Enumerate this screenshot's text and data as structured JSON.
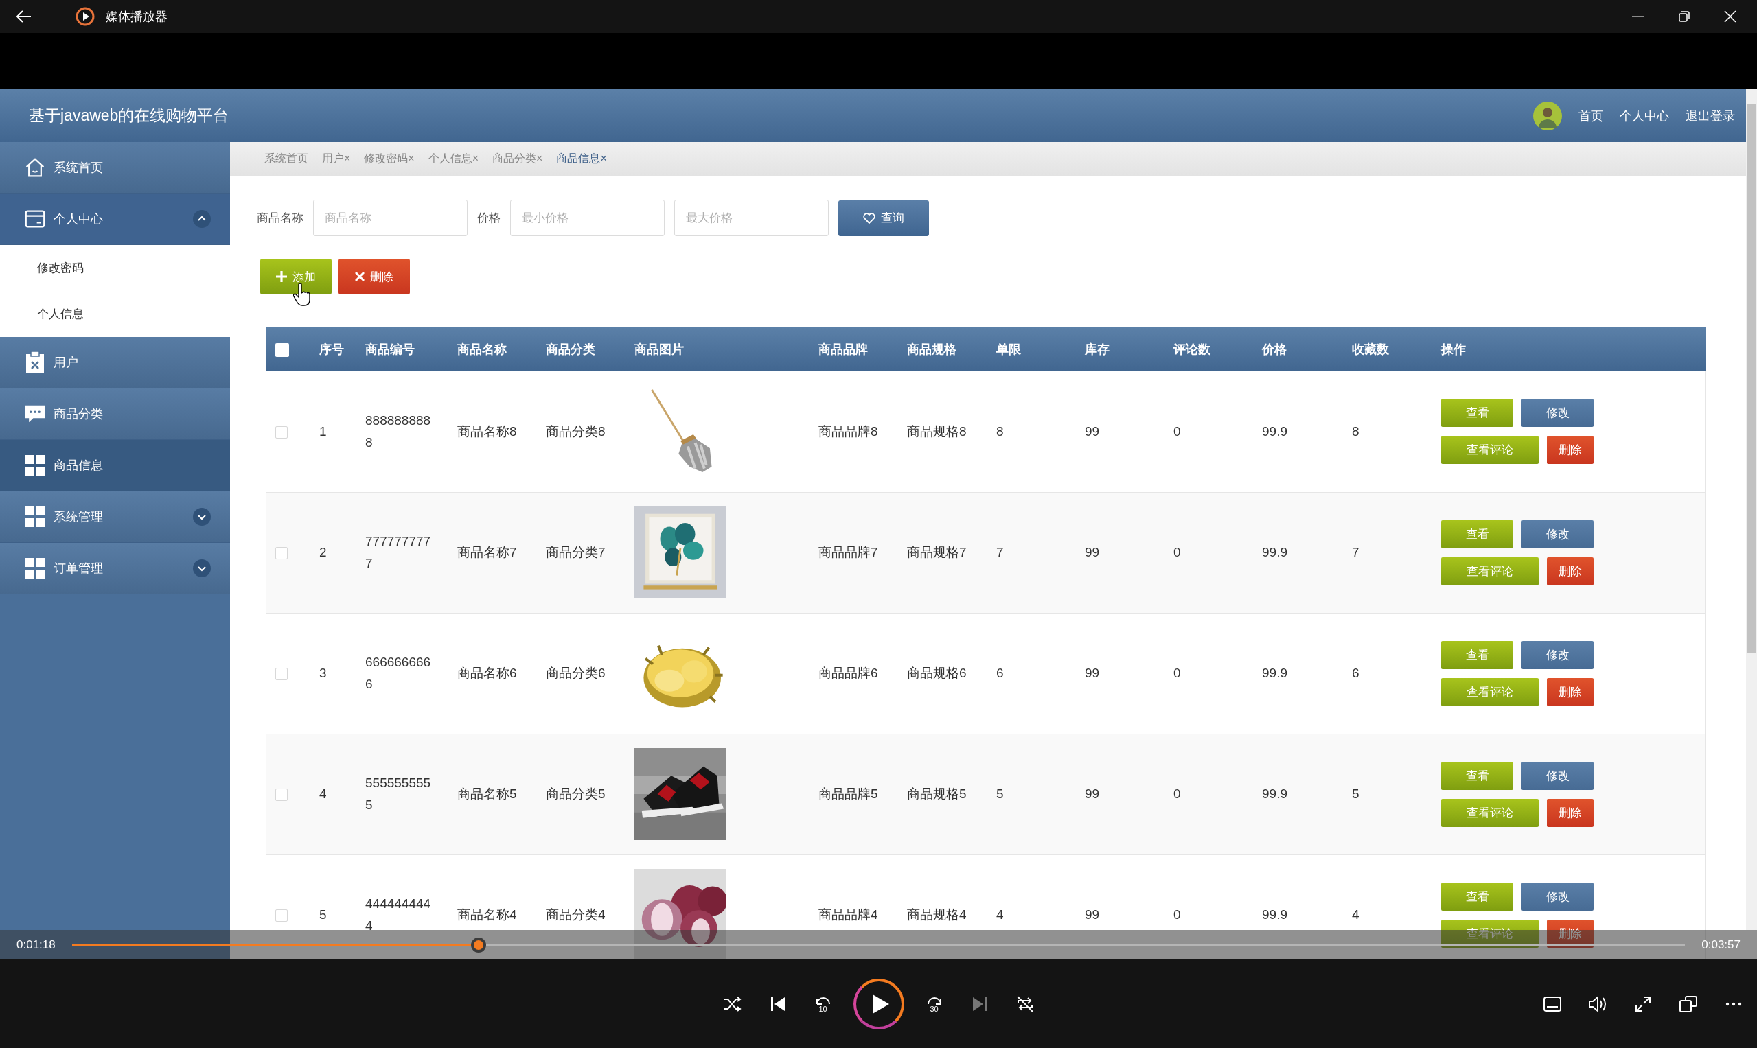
{
  "window": {
    "title": "媒体播放器"
  },
  "app": {
    "title": "基于javaweb的在线购物平台",
    "nav": [
      "首页",
      "个人中心",
      "退出登录"
    ],
    "sidebar": {
      "items": [
        {
          "label": "系统首页",
          "selected": false
        },
        {
          "label": "个人中心",
          "selected": false,
          "expanded": true,
          "children": [
            {
              "label": "修改密码"
            },
            {
              "label": "个人信息"
            }
          ]
        },
        {
          "label": "用户",
          "selected": false
        },
        {
          "label": "商品分类",
          "selected": false
        },
        {
          "label": "商品信息",
          "selected": true
        },
        {
          "label": "系统管理",
          "selected": false,
          "expanded": false
        },
        {
          "label": "订单管理",
          "selected": false,
          "expanded": false
        }
      ]
    },
    "tabs": [
      {
        "label": "系统首页",
        "selected": false
      },
      {
        "label": "用户",
        "close": "×",
        "selected": false
      },
      {
        "label": "修改密码",
        "close": "×",
        "selected": false
      },
      {
        "label": "个人信息",
        "close": "×",
        "selected": false
      },
      {
        "label": "商品分类",
        "close": "×",
        "selected": false
      },
      {
        "label": "商品信息",
        "close": "×",
        "selected": true
      }
    ],
    "search": {
      "fields": [
        {
          "label": "商品名称",
          "placeholder": "商品名称"
        },
        {
          "label": "价格",
          "placeholder": "最小价格"
        },
        {
          "placeholder": "最大价格"
        }
      ],
      "button": "查询"
    },
    "actions": [
      {
        "label": "添加",
        "kind": "add"
      },
      {
        "label": "删除",
        "kind": "delete"
      }
    ],
    "table": {
      "header_checked": false,
      "columns": [
        "序号",
        "商品编号",
        "商品名称",
        "商品分类",
        "商品图片",
        "商品品牌",
        "商品规格",
        "单限",
        "库存",
        "评论数",
        "价格",
        "收藏数",
        "操作"
      ],
      "rows": [
        {
          "checked": false,
          "cells": [
            "1",
            "8888888888",
            "商品名称8",
            "商品分类8",
            null,
            "商品品牌8",
            "商品规格8",
            "8",
            "99",
            "0",
            "99.9",
            "8"
          ],
          "operations": [
            {
              "label": "查看",
              "kind": "view"
            },
            {
              "label": "修改",
              "kind": "edit"
            },
            {
              "label": "查看评论",
              "kind": "view"
            },
            {
              "label": "删除",
              "kind": "delete"
            }
          ]
        },
        {
          "checked": false,
          "cells": [
            "2",
            "7777777777",
            "商品名称7",
            "商品分类7",
            null,
            "商品品牌7",
            "商品规格7",
            "7",
            "99",
            "0",
            "99.9",
            "7"
          ],
          "operations": [
            {
              "label": "查看",
              "kind": "view"
            },
            {
              "label": "修改",
              "kind": "edit"
            },
            {
              "label": "查看评论",
              "kind": "view"
            },
            {
              "label": "删除",
              "kind": "delete"
            }
          ]
        },
        {
          "checked": false,
          "cells": [
            "3",
            "6666666666",
            "商品名称6",
            "商品分类6",
            null,
            "商品品牌6",
            "商品规格6",
            "6",
            "99",
            "0",
            "99.9",
            "6"
          ],
          "operations": [
            {
              "label": "查看",
              "kind": "view"
            },
            {
              "label": "修改",
              "kind": "edit"
            },
            {
              "label": "查看评论",
              "kind": "view"
            },
            {
              "label": "删除",
              "kind": "delete"
            }
          ]
        },
        {
          "checked": false,
          "cells": [
            "4",
            "5555555555",
            "商品名称5",
            "商品分类5",
            null,
            "商品品牌5",
            "商品规格5",
            "5",
            "99",
            "0",
            "99.9",
            "5"
          ],
          "operations": [
            {
              "label": "查看",
              "kind": "view"
            },
            {
              "label": "修改",
              "kind": "edit"
            },
            {
              "label": "查看评论",
              "kind": "view"
            },
            {
              "label": "删除",
              "kind": "delete"
            }
          ]
        },
        {
          "checked": false,
          "cells": [
            "5",
            "4444444444",
            "商品名称4",
            "商品分类4",
            null,
            "商品品牌4",
            "商品规格4",
            "4",
            "99",
            "0",
            "99.9",
            "4"
          ],
          "operations": [
            {
              "label": "查看",
              "kind": "view"
            },
            {
              "label": "修改",
              "kind": "edit"
            },
            {
              "label": "查看评论",
              "kind": "view"
            },
            {
              "label": "删除",
              "kind": "delete"
            }
          ]
        }
      ]
    }
  },
  "player": {
    "elapsed": "0:01:18",
    "total": "0:03:57",
    "level": 0.252,
    "controls": [
      {
        "kind": "shuffle",
        "disabled": false
      },
      {
        "kind": "previous",
        "disabled": false
      },
      {
        "kind": "rewind",
        "label": "10",
        "disabled": false
      },
      {
        "kind": "play",
        "disabled": false
      },
      {
        "kind": "forward",
        "label": "30",
        "disabled": false
      },
      {
        "kind": "next",
        "disabled": true
      },
      {
        "kind": "repeat",
        "disabled": false
      }
    ],
    "right_controls": [
      {
        "kind": "subtitles"
      },
      {
        "kind": "volume"
      },
      {
        "kind": "fullscreen"
      },
      {
        "kind": "miniview"
      },
      {
        "kind": "more"
      }
    ]
  }
}
